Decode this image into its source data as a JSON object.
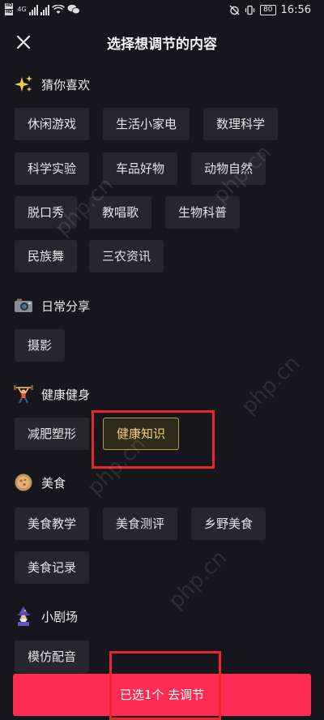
{
  "status_bar": {
    "hd1": "HD",
    "hd2": "HD",
    "net": "4G",
    "time": "16:56",
    "battery": "80"
  },
  "header": {
    "title": "选择想调节的内容"
  },
  "sections": [
    {
      "title": "猜你喜欢",
      "icon": "sparkles-icon",
      "tags": [
        "休闲游戏",
        "生活小家电",
        "数理科学",
        "科学实验",
        "车品好物",
        "动物自然",
        "脱口秀",
        "教唱歌",
        "生物科普",
        "民族舞",
        "三农资讯"
      ]
    },
    {
      "title": "日常分享",
      "icon": "camera-icon",
      "tags": [
        "摄影"
      ]
    },
    {
      "title": "健康健身",
      "icon": "weightlifter-icon",
      "tags": [
        "减肥塑形",
        "健康知识"
      ]
    },
    {
      "title": "美食",
      "icon": "food-icon",
      "tags": [
        "美食教学",
        "美食测评",
        "乡野美食",
        "美食记录"
      ]
    },
    {
      "title": "小剧场",
      "icon": "wizard-icon",
      "tags": [
        "模仿配音"
      ]
    }
  ],
  "selected_tag": "健康知识",
  "bottom_button": "已选1个 去调节",
  "watermark": "php.cn",
  "colors": {
    "accent": "#fe2c55",
    "selected_text": "#f2d17a",
    "highlight": "#e8262c"
  }
}
